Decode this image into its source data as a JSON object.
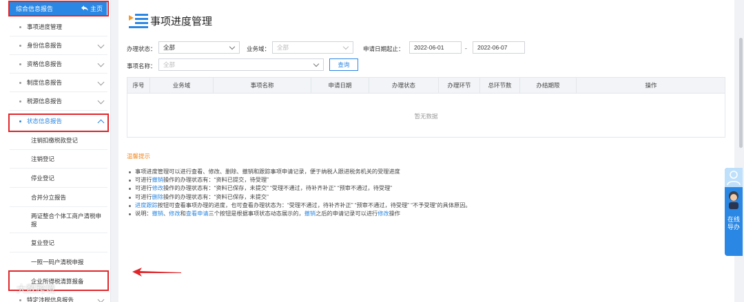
{
  "sidebar": {
    "header_title": "综合信息报告",
    "home_label": "主页",
    "items": [
      {
        "label": "事项进度管理"
      },
      {
        "label": "身份信息报告"
      },
      {
        "label": "资格信息报告"
      },
      {
        "label": "制度信息报告"
      },
      {
        "label": "税源信息报告"
      },
      {
        "label": "状态信息报告"
      }
    ],
    "sub_items": [
      {
        "label": "注销扣缴税款登记"
      },
      {
        "label": "注销登记"
      },
      {
        "label": "停业登记"
      },
      {
        "label": "合并分立报告"
      },
      {
        "label": "两证整合个体工商户清税申报"
      },
      {
        "label": "复业登记"
      },
      {
        "label": "一照一码户清税申报"
      },
      {
        "label": "企业所得税清算报备"
      }
    ],
    "last_item": {
      "label": "特定涉税信息报告"
    }
  },
  "main": {
    "title": "事项进度管理",
    "filters": {
      "status_label": "办理状态：",
      "status_value": "全部",
      "domain_label": "业务域：",
      "domain_value": "全部",
      "date_label": "申请日期起止：",
      "date_start": "2022-06-01",
      "date_sep": "-",
      "date_end": "2022-06-07",
      "item_label": "事项名称：",
      "item_value": "全部",
      "query_button": "查询"
    },
    "table": {
      "columns": [
        "序号",
        "业务域",
        "事项名称",
        "申请日期",
        "办理状态",
        "办理环节",
        "总环节数",
        "办结期限",
        "操作"
      ],
      "empty_text": "暂无数据"
    },
    "tips": {
      "title": "温馨提示",
      "lines": [
        {
          "segments": [
            {
              "t": "事项进度管理可以进行查看、修改、删除、撤销和跟踪事项申请记录，便于纳税人跟进税务机关的受理进度",
              "hl": false
            }
          ]
        },
        {
          "segments": [
            {
              "t": "可进行",
              "hl": false
            },
            {
              "t": "撤销",
              "hl": true
            },
            {
              "t": "操作的办理状态有：“资料已提交，待受理”",
              "hl": false
            }
          ]
        },
        {
          "segments": [
            {
              "t": "可进行",
              "hl": false
            },
            {
              "t": "修改",
              "hl": true
            },
            {
              "t": "操作的办理状态有：“资料已保存，未提交” “受理不通过，待补齐补正” “预审不通过，待受理”",
              "hl": false
            }
          ]
        },
        {
          "segments": [
            {
              "t": "可进行",
              "hl": false
            },
            {
              "t": "删除",
              "hl": true
            },
            {
              "t": "操作的办理状态有：“资料已保存，未提交”",
              "hl": false
            }
          ]
        },
        {
          "segments": [
            {
              "t": "进度跟踪",
              "hl": true
            },
            {
              "t": "按钮可查看事项办理的进度，也可查看办理状态为：“受理不通过，待补齐补正” “预审不通过，待受理” “不予受理”的具体原因。",
              "hl": false
            }
          ]
        },
        {
          "segments": [
            {
              "t": "说明：",
              "hl": false
            },
            {
              "t": "撤销",
              "hl": true
            },
            {
              "t": "、",
              "hl": false
            },
            {
              "t": "修改",
              "hl": true
            },
            {
              "t": "和",
              "hl": false
            },
            {
              "t": "查看申请",
              "hl": true
            },
            {
              "t": "三个按钮是根据事项状态动态展示的，",
              "hl": false
            },
            {
              "t": "撤销",
              "hl": true
            },
            {
              "t": "之后的申请记录可以进行",
              "hl": false
            },
            {
              "t": "修改",
              "hl": true
            },
            {
              "t": "操作",
              "hl": false
            }
          ]
        }
      ]
    }
  },
  "widget": {
    "label": "在线导办"
  },
  "watermark": "大数跨境",
  "colors": {
    "accent": "#2a87e3",
    "highlight_box": "#e0262a",
    "tips_title": "#f08a24",
    "arrow": "#e0262a"
  }
}
